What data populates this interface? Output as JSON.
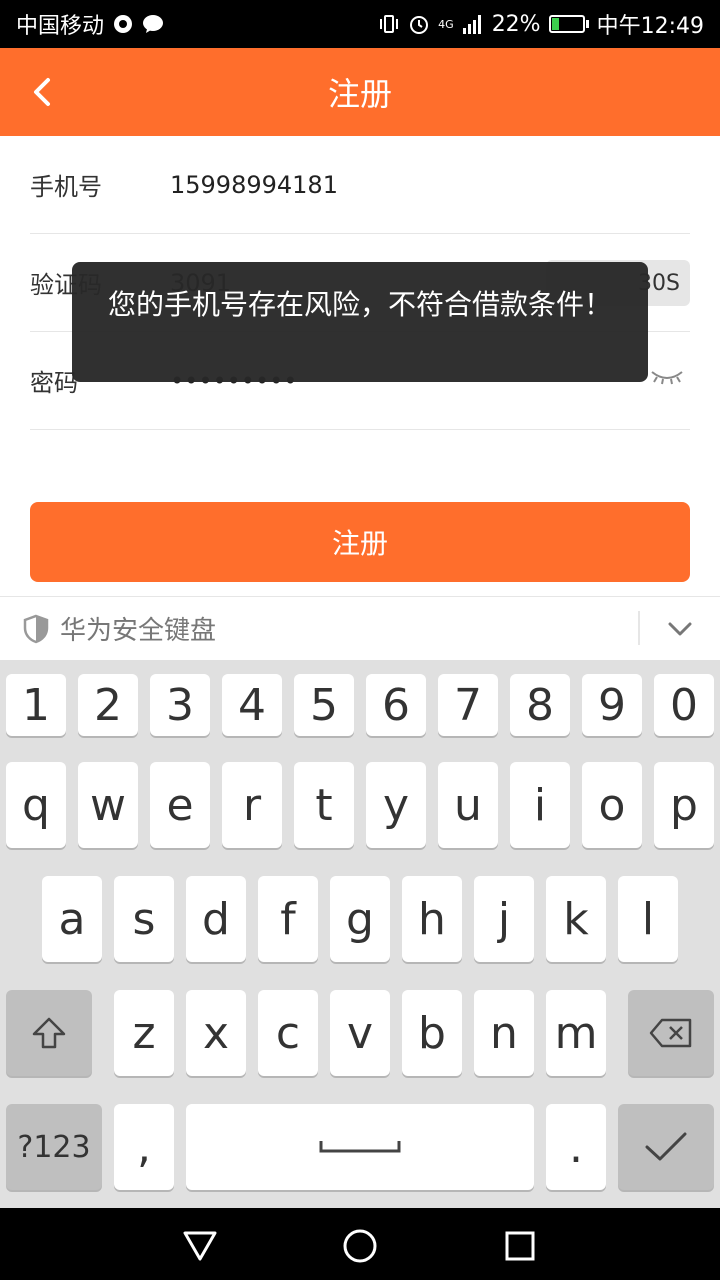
{
  "status_bar": {
    "carrier": "中国移动",
    "network": "4G",
    "battery": "22%",
    "time": "中午12:49",
    "battery_level": 0.22
  },
  "header": {
    "title": "注册"
  },
  "form": {
    "phone": {
      "label": "手机号",
      "value": "15998994181"
    },
    "code": {
      "label": "验证码",
      "value": "3091",
      "countdown": "30S"
    },
    "password": {
      "label": "密码",
      "value": "•••••••••"
    }
  },
  "register_button": "注册",
  "toast": {
    "message": "您的手机号存在风险，不符合借款条件！"
  },
  "keyboard": {
    "title": "华为安全键盘",
    "number_row": [
      "1",
      "2",
      "3",
      "4",
      "5",
      "6",
      "7",
      "8",
      "9",
      "0"
    ],
    "row1": [
      "q",
      "w",
      "e",
      "r",
      "t",
      "y",
      "u",
      "i",
      "o",
      "p"
    ],
    "row2": [
      "a",
      "s",
      "d",
      "f",
      "g",
      "h",
      "j",
      "k",
      "l"
    ],
    "row3": [
      "z",
      "x",
      "c",
      "v",
      "b",
      "n",
      "m"
    ],
    "bottom": {
      "symbols": "?123",
      "comma": ",",
      "period": "."
    }
  },
  "colors": {
    "accent": "#ff6e2c",
    "keyboard_bg": "#e0e0e0"
  }
}
